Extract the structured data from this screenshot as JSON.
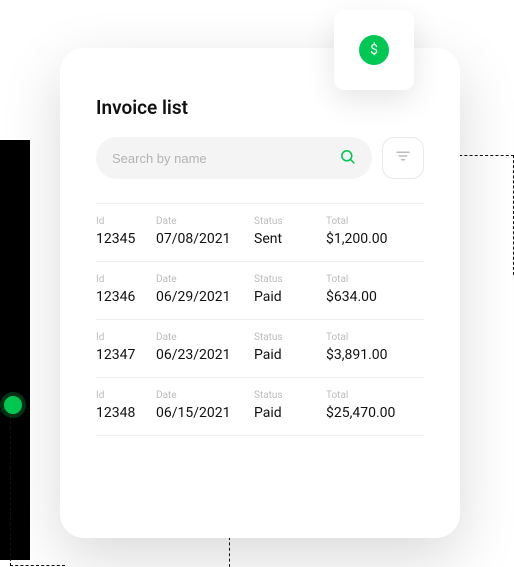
{
  "header": {
    "title": "Invoice list"
  },
  "search": {
    "placeholder": "Search by name"
  },
  "badge": {
    "symbol": "$"
  },
  "columns": {
    "id": "Id",
    "date": "Date",
    "status": "Status",
    "total": "Total"
  },
  "invoices": [
    {
      "id": "12345",
      "date": "07/08/2021",
      "status": "Sent",
      "total": "$1,200.00"
    },
    {
      "id": "12346",
      "date": "06/29/2021",
      "status": "Paid",
      "total": "$634.00"
    },
    {
      "id": "12347",
      "date": "06/23/2021",
      "status": "Paid",
      "total": "$3,891.00"
    },
    {
      "id": "12348",
      "date": "06/15/2021",
      "status": "Paid",
      "total": "$25,470.00"
    }
  ]
}
